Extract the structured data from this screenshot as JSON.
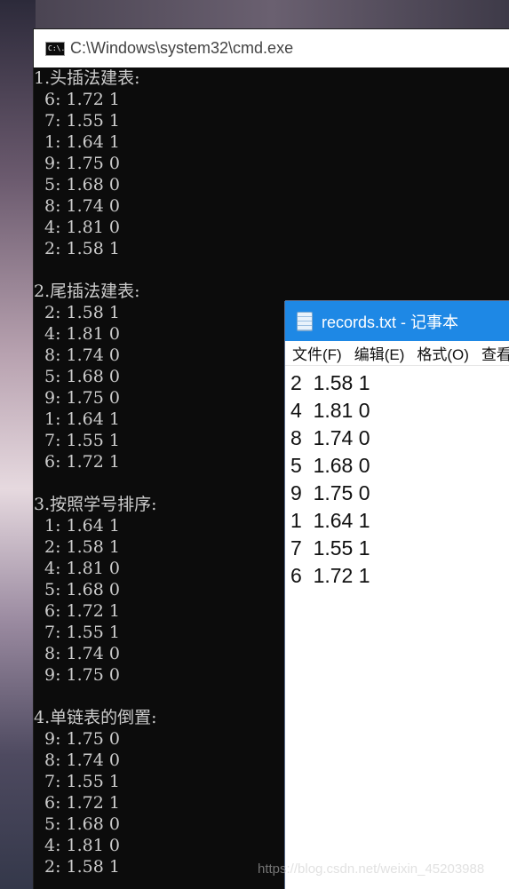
{
  "cmd": {
    "title": "C:\\Windows\\system32\\cmd.exe",
    "icon_text": "C:\\.",
    "lines": [
      "1.头插法建表:",
      "6: 1.72 1",
      "7: 1.55 1",
      "1: 1.64 1",
      "9: 1.75 0",
      "5: 1.68 0",
      "8: 1.74 0",
      "4: 1.81 0",
      "2: 1.58 1",
      "",
      "2.尾插法建表:",
      "2: 1.58 1",
      "4: 1.81 0",
      "8: 1.74 0",
      "5: 1.68 0",
      "9: 1.75 0",
      "1: 1.64 1",
      "7: 1.55 1",
      "6: 1.72 1",
      "",
      "3.按照学号排序:",
      "1: 1.64 1",
      "2: 1.58 1",
      "4: 1.81 0",
      "5: 1.68 0",
      "6: 1.72 1",
      "7: 1.55 1",
      "8: 1.74 0",
      "9: 1.75 0",
      "",
      "4.单链表的倒置:",
      "9: 1.75 0",
      "8: 1.74 0",
      "7: 1.55 1",
      "6: 1.72 1",
      "5: 1.68 0",
      "4: 1.81 0",
      "2: 1.58 1"
    ]
  },
  "notepad": {
    "title": "records.txt - 记事本",
    "menu": [
      "文件(F)",
      "编辑(E)",
      "格式(O)",
      "查看"
    ],
    "lines": [
      "2  1.58 1",
      "4  1.81 0",
      "8  1.74 0",
      "5  1.68 0",
      "9  1.75 0",
      "1  1.64 1",
      "7  1.55 1",
      "6  1.72 1"
    ]
  },
  "watermark": "https://blog.csdn.net/weixin_45203988"
}
